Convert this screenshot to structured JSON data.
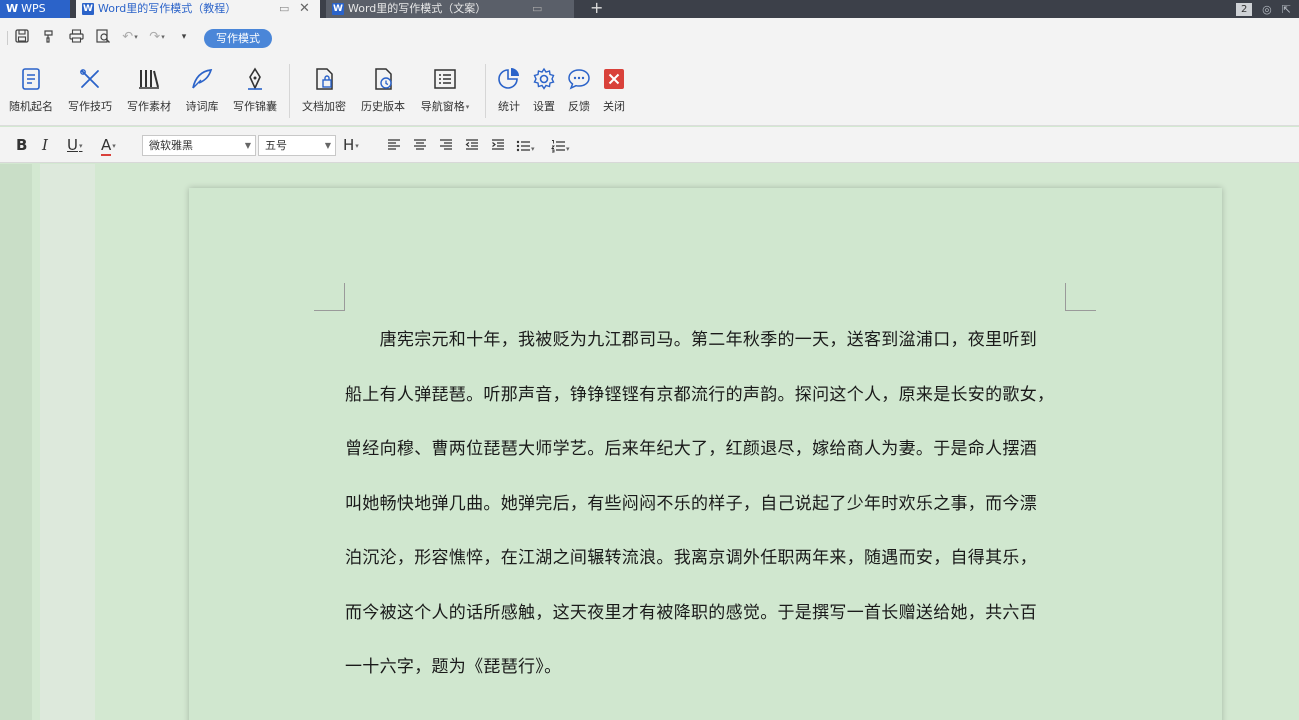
{
  "titlebar": {
    "app_tab": "WPS",
    "tabs": [
      {
        "label": "Word里的写作模式（教程）",
        "active": true
      },
      {
        "label": "Word里的写作模式（文案）",
        "active": false
      }
    ],
    "window_count": "2"
  },
  "quickbar": {
    "mode_label": "写作模式"
  },
  "ribbon": {
    "buttons": [
      {
        "label": "随机起名",
        "icon": "random-name-icon"
      },
      {
        "label": "写作技巧",
        "icon": "writing-tips-icon"
      },
      {
        "label": "写作素材",
        "icon": "writing-material-icon"
      },
      {
        "label": "诗词库",
        "icon": "poetry-library-icon"
      },
      {
        "label": "写作锦囊",
        "icon": "writing-kit-icon"
      },
      {
        "label": "文档加密",
        "icon": "encrypt-icon"
      },
      {
        "label": "历史版本",
        "icon": "history-icon"
      },
      {
        "label": "导航窗格",
        "icon": "navigation-icon"
      },
      {
        "label": "统计",
        "icon": "stats-icon"
      },
      {
        "label": "设置",
        "icon": "settings-icon"
      },
      {
        "label": "反馈",
        "icon": "feedback-icon"
      },
      {
        "label": "关闭",
        "icon": "close-icon"
      }
    ]
  },
  "format": {
    "font_name": "微软雅黑",
    "font_size": "五号",
    "bold": "B",
    "italic": "I",
    "underline": "U",
    "font_color": "A",
    "heading": "H"
  },
  "document": {
    "lines": [
      "　　唐宪宗元和十年，我被贬为九江郡司马。第二年秋季的一天，送客到湓浦口，夜里听到",
      "船上有人弹琵琶。听那声音，铮铮铿铿有京都流行的声韵。探问这个人，原来是长安的歌女，",
      "曾经向穆、曹两位琵琶大师学艺。后来年纪大了，红颜退尽，嫁给商人为妻。于是命人摆酒",
      "叫她畅快地弹几曲。她弹完后，有些闷闷不乐的样子，自己说起了少年时欢乐之事，而今漂",
      "泊沉沦，形容憔悴，在江湖之间辗转流浪。我离京调外任职两年来，随遇而安，自得其乐，",
      "而今被这个人的话所感触，这天夜里才有被降职的感觉。于是撰写一首长赠送给她，共六百",
      "一十六字，题为《琵琶行》。"
    ]
  },
  "colors": {
    "accent": "#2b63c9",
    "page_bg": "#d0e7cf",
    "close_red": "#d9413a"
  }
}
